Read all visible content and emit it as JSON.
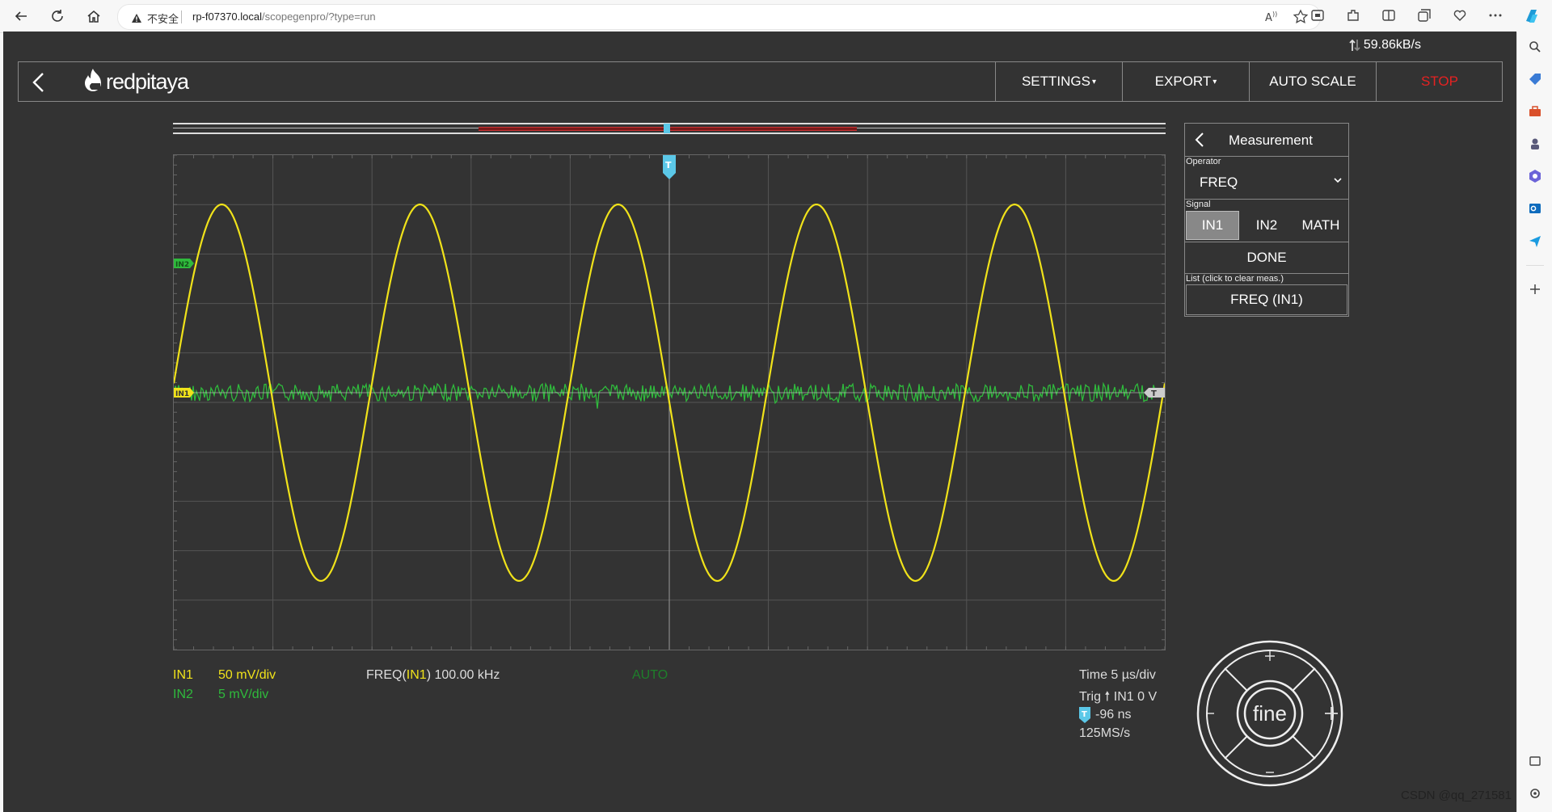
{
  "browser": {
    "security_label": "不安全",
    "url_host": "rp-f07370.local",
    "url_path": "/scopegenpro/?type=run"
  },
  "app": {
    "speed": "59.86kB/s",
    "menu": {
      "settings": "SETTINGS",
      "export": "EXPORT",
      "autoscale": "AUTO SCALE",
      "stop": "STOP"
    },
    "logo_text": "redpitaya",
    "colors": {
      "in1": "#f0e21a",
      "in2": "#2fba3c",
      "stop": "#e52222",
      "trigger": "#5bc8e8",
      "background": "#333333"
    }
  },
  "graph_markers": {
    "in1": "IN1",
    "in2": "IN2",
    "trigger": "T"
  },
  "status": {
    "in1_label": "IN1",
    "in1_scale": "50 mV/div",
    "in2_label": "IN2",
    "in2_scale": "5 mV/div",
    "meas_prefix": "FREQ(",
    "meas_channel": "IN1",
    "meas_suffix": ") 100.00 kHz",
    "trigger_mode": "AUTO",
    "time": "Time 5 µs/div",
    "trig": "Trig",
    "trig_src": "IN1 0 V",
    "trig_delay": "-96 ns",
    "sample_rate": "125MS/s"
  },
  "measurement": {
    "title": "Measurement",
    "operator_label": "Operator",
    "operator_value": "FREQ",
    "signal_label": "Signal",
    "signals": [
      "IN1",
      "IN2",
      "MATH"
    ],
    "selected_signal": "IN1",
    "done": "DONE",
    "list_label": "List (click to clear meas.)",
    "list_item": "FREQ (IN1)"
  },
  "dial": {
    "center": "fine"
  },
  "watermark": "CSDN @qq_271581"
}
